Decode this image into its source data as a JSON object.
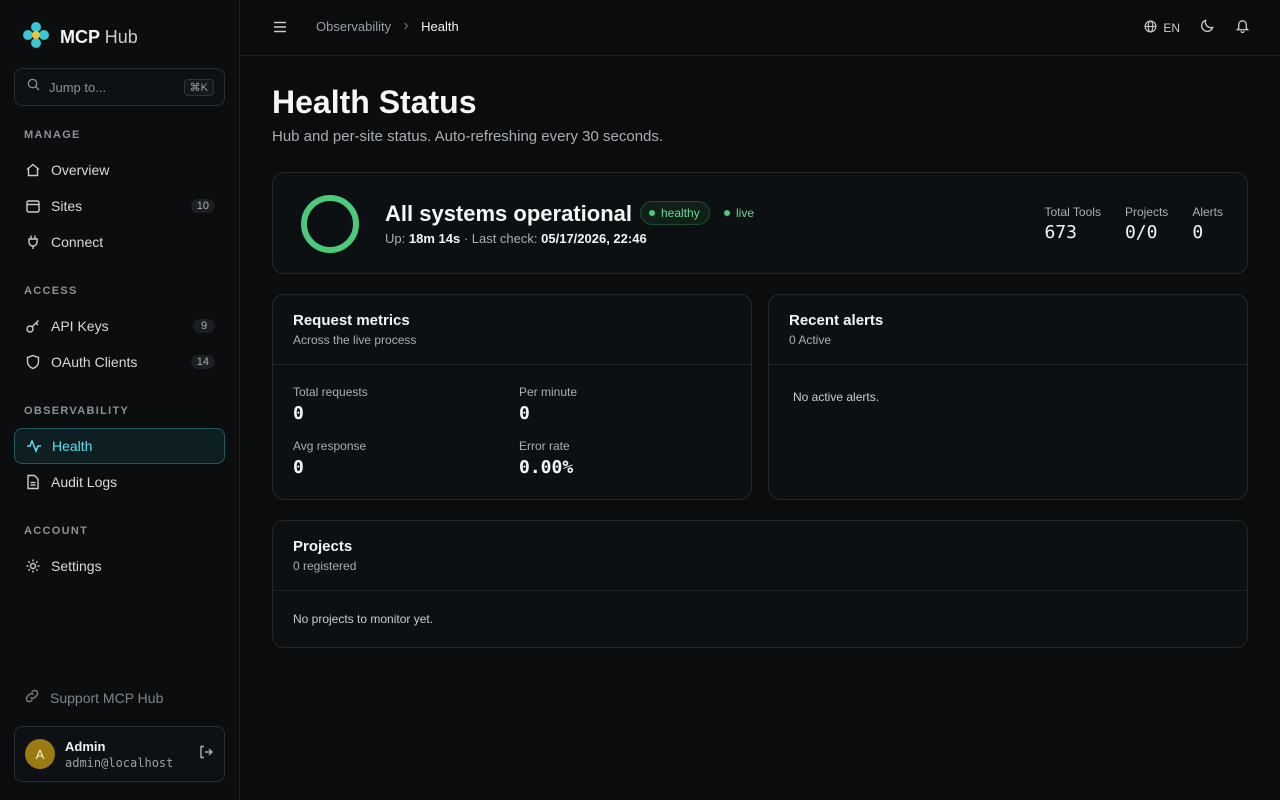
{
  "brand": {
    "name_bold": "MCP",
    "name_light": "Hub"
  },
  "search": {
    "placeholder": "Jump to...",
    "shortcut": "⌘K"
  },
  "sidebar": {
    "sections": [
      {
        "title": "MANAGE"
      },
      {
        "title": "ACCESS"
      },
      {
        "title": "OBSERVABILITY"
      },
      {
        "title": "ACCOUNT"
      }
    ],
    "items": [
      {
        "label": "Overview",
        "icon": "home-icon"
      },
      {
        "label": "Sites",
        "icon": "calendar-icon",
        "count": "10"
      },
      {
        "label": "Connect",
        "icon": "plug-icon"
      },
      {
        "label": "API Keys",
        "icon": "key-icon",
        "count": "9"
      },
      {
        "label": "OAuth Clients",
        "icon": "shield-icon",
        "count": "14"
      },
      {
        "label": "Health",
        "icon": "activity-icon",
        "active": true
      },
      {
        "label": "Audit Logs",
        "icon": "file-icon"
      },
      {
        "label": "Settings",
        "icon": "gear-icon"
      }
    ],
    "support_label": "Support MCP Hub",
    "user": {
      "initial": "A",
      "name": "Admin",
      "email": "admin@localhost"
    }
  },
  "topbar": {
    "breadcrumb": [
      "Observability",
      "Health"
    ],
    "lang": "EN"
  },
  "page": {
    "title": "Health Status",
    "subtitle": "Hub and per-site status. Auto-refreshing every 30 seconds."
  },
  "status": {
    "title": "All systems operational",
    "badge": "healthy",
    "live": "live",
    "uptime_label": "Up:",
    "uptime_value": "18m 14s",
    "last_check_label": "· Last check:",
    "last_check_value": "05/17/2026, 22:46",
    "stats": [
      {
        "label": "Total Tools",
        "value": "673"
      },
      {
        "label": "Projects",
        "value": "0/0"
      },
      {
        "label": "Alerts",
        "value": "0"
      }
    ],
    "colors": {
      "healthy": "#4cc97a",
      "accent": "#5fe0ea"
    }
  },
  "metrics": {
    "title": "Request metrics",
    "subtitle": "Across the live process",
    "items": [
      {
        "label": "Total requests",
        "value": "0"
      },
      {
        "label": "Per minute",
        "value": "0"
      },
      {
        "label": "Avg response",
        "value": "0"
      },
      {
        "label": "Error rate",
        "value": "0.00%"
      }
    ]
  },
  "alerts": {
    "title": "Recent alerts",
    "subtitle": "0 Active",
    "empty": "No active alerts."
  },
  "projects": {
    "title": "Projects",
    "subtitle": "0 registered",
    "empty": "No projects to monitor yet."
  }
}
